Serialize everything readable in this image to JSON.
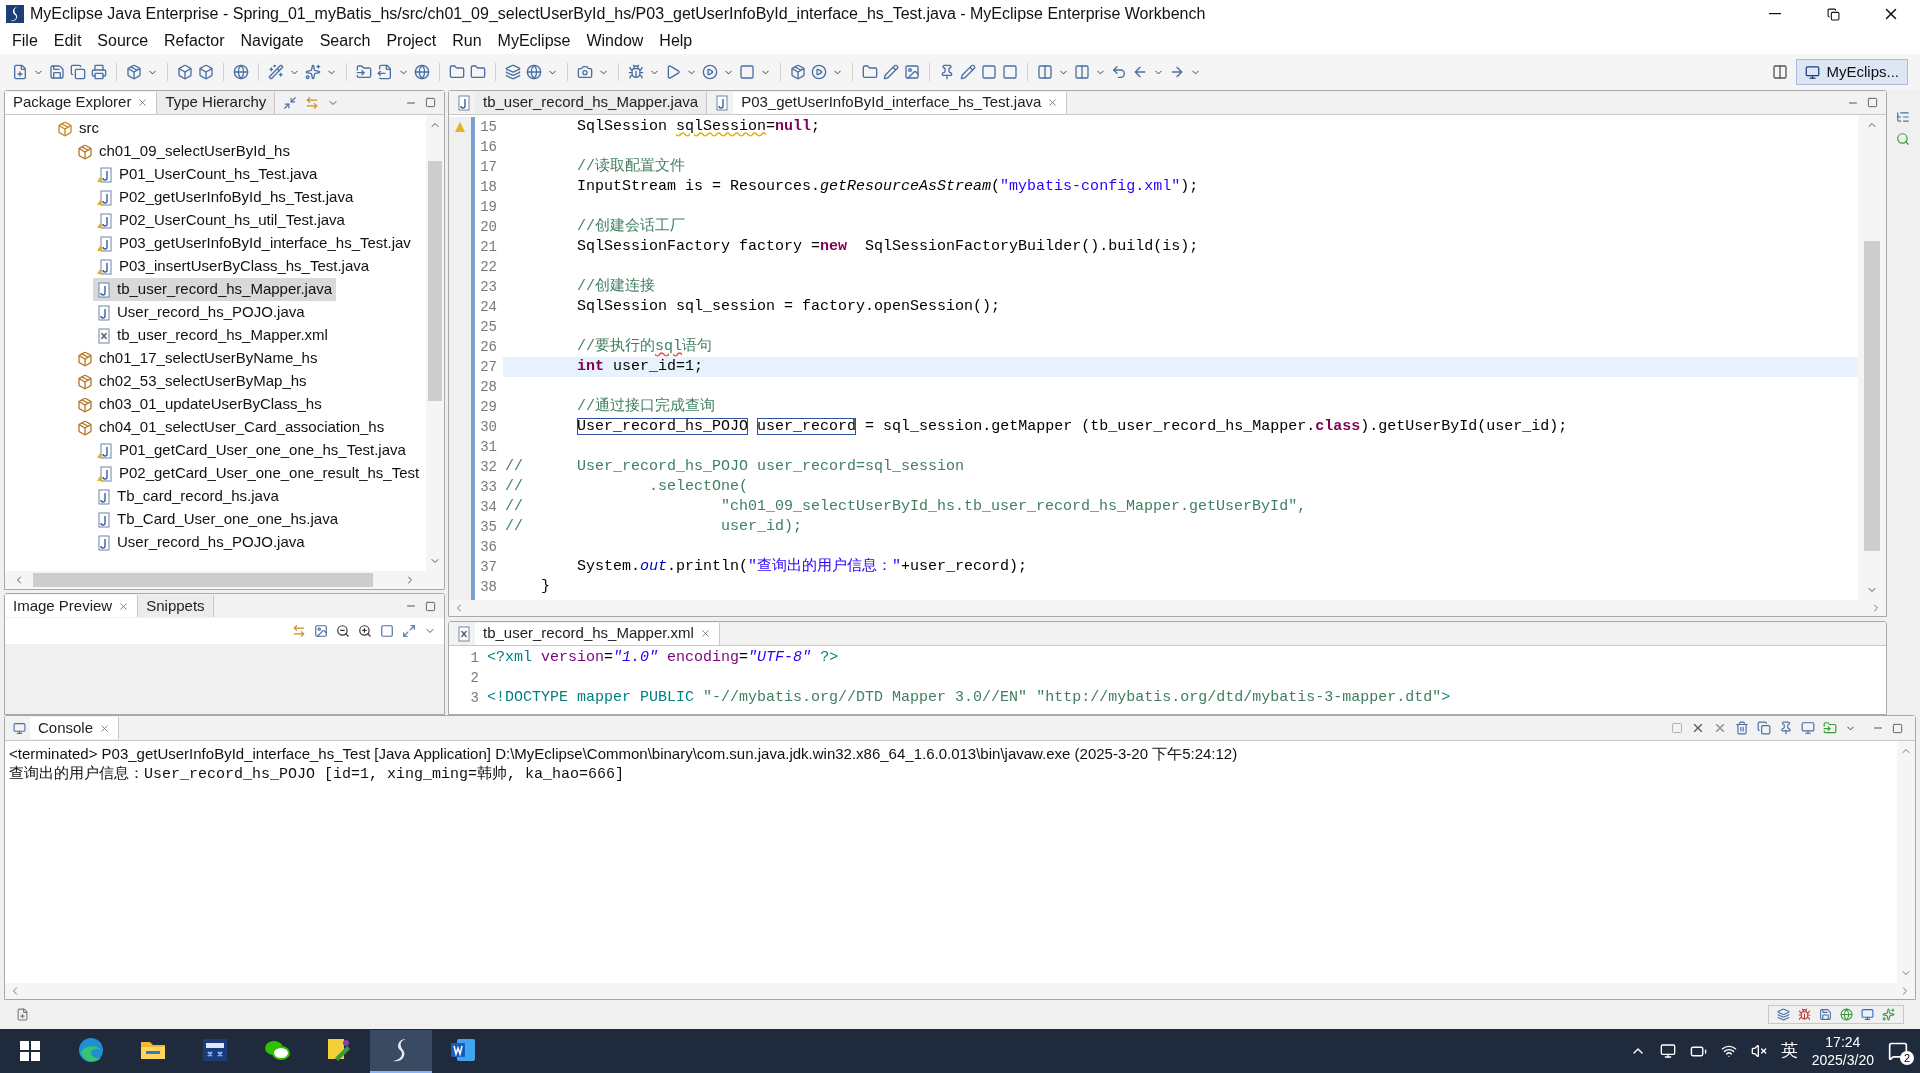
{
  "window": {
    "title": "MyEclipse Java Enterprise - Spring_01_myBatis_hs/src/ch01_09_selectUserById_hs/P03_getUserInfoById_interface_hs_Test.java - MyEclipse Enterprise Workbench"
  },
  "menu": [
    "File",
    "Edit",
    "Source",
    "Refactor",
    "Navigate",
    "Search",
    "Project",
    "Run",
    "MyEclipse",
    "Window",
    "Help"
  ],
  "perspective": {
    "label": "MyEclips..."
  },
  "package_explorer": {
    "tabs": [
      {
        "label": "Package Explorer",
        "selected": true
      },
      {
        "label": "Type Hierarchy",
        "selected": false
      }
    ],
    "tree": [
      {
        "label": "src",
        "kind": "source-folder",
        "selected": false,
        "children": [
          {
            "label": "ch01_09_selectUserById_hs",
            "kind": "package",
            "selected": false,
            "children": [
              {
                "label": "P01_UserCount_hs_Test.java",
                "kind": "java-warning",
                "selected": false
              },
              {
                "label": "P02_getUserInfoById_hs_Test.java",
                "kind": "java-warning",
                "selected": false
              },
              {
                "label": "P02_UserCount_hs_util_Test.java",
                "kind": "java-warning",
                "selected": false
              },
              {
                "label": "P03_getUserInfoById_interface_hs_Test.jav",
                "kind": "java-warning",
                "selected": false
              },
              {
                "label": "P03_insertUserByClass_hs_Test.java",
                "kind": "java-warning",
                "selected": false
              },
              {
                "label": "tb_user_record_hs_Mapper.java",
                "kind": "java",
                "selected": true
              },
              {
                "label": "User_record_hs_POJO.java",
                "kind": "java",
                "selected": false
              },
              {
                "label": "tb_user_record_hs_Mapper.xml",
                "kind": "xml",
                "selected": false
              }
            ]
          },
          {
            "label": "ch01_17_selectUserByName_hs",
            "kind": "package",
            "selected": false
          },
          {
            "label": "ch02_53_selectUserByMap_hs",
            "kind": "package",
            "selected": false
          },
          {
            "label": "ch03_01_updateUserByClass_hs",
            "kind": "package",
            "selected": false
          },
          {
            "label": "ch04_01_selectUser_Card_association_hs",
            "kind": "package",
            "selected": false,
            "children": [
              {
                "label": "P01_getCard_User_one_one_hs_Test.java",
                "kind": "java-warning",
                "selected": false
              },
              {
                "label": "P02_getCard_User_one_one_result_hs_Test",
                "kind": "java-warning",
                "selected": false
              },
              {
                "label": "Tb_card_record_hs.java",
                "kind": "java",
                "selected": false
              },
              {
                "label": "Tb_Card_User_one_one_hs.java",
                "kind": "java",
                "selected": false
              },
              {
                "label": "User_record_hs_POJO.java",
                "kind": "java",
                "selected": false
              }
            ]
          }
        ]
      }
    ]
  },
  "image_preview": {
    "tabs": [
      {
        "label": "Image Preview",
        "selected": true
      },
      {
        "label": "Snippets",
        "selected": false
      }
    ]
  },
  "editor": {
    "tabs": [
      {
        "label": "tb_user_record_hs_Mapper.java",
        "selected": false
      },
      {
        "label": "P03_getUserInfoById_interface_hs_Test.java",
        "selected": true
      }
    ],
    "lines": [
      {
        "number": "15",
        "current": false,
        "warning": true,
        "tokens": [
          {
            "text": "        SqlSession ",
            "kind": "plain"
          },
          {
            "text": "sqlSession",
            "kind": "warn"
          },
          {
            "text": "=",
            "kind": "plain"
          },
          {
            "text": "null",
            "kind": "keyword"
          },
          {
            "text": ";",
            "kind": "plain"
          }
        ]
      },
      {
        "number": "16",
        "current": false,
        "warning": false
      },
      {
        "number": "17",
        "current": false,
        "warning": false,
        "tokens": [
          {
            "text": "        //读取配置文件",
            "kind": "comment"
          }
        ]
      },
      {
        "number": "18",
        "current": false,
        "warning": false,
        "tokens": [
          {
            "text": "        InputStream is = Resources.",
            "kind": "plain"
          },
          {
            "text": "getResourceAsStream",
            "kind": "italic"
          },
          {
            "text": "(",
            "kind": "plain"
          },
          {
            "text": "\"mybatis-config.xml\"",
            "kind": "string"
          },
          {
            "text": ");",
            "kind": "plain"
          }
        ]
      },
      {
        "number": "19",
        "current": false,
        "warning": false
      },
      {
        "number": "20",
        "current": false,
        "warning": false,
        "tokens": [
          {
            "text": "        //创建会话工厂",
            "kind": "comment"
          }
        ]
      },
      {
        "number": "21",
        "current": false,
        "warning": false,
        "tokens": [
          {
            "text": "        SqlSessionFactory factory =",
            "kind": "plain"
          },
          {
            "text": "new",
            "kind": "keyword"
          },
          {
            "text": "  SqlSessionFactoryBuilder().build(is);",
            "kind": "plain"
          }
        ]
      },
      {
        "number": "22",
        "current": false,
        "warning": false
      },
      {
        "number": "23",
        "current": false,
        "warning": false,
        "tokens": [
          {
            "text": "        //创建连接",
            "kind": "comment"
          }
        ]
      },
      {
        "number": "24",
        "current": false,
        "warning": false,
        "tokens": [
          {
            "text": "        SqlSession sql_session = factory.openSession();",
            "kind": "plain"
          }
        ]
      },
      {
        "number": "25",
        "current": false,
        "warning": false
      },
      {
        "number": "26",
        "current": false,
        "warning": false,
        "tokens": [
          {
            "text": "        //要执行的",
            "kind": "comment"
          },
          {
            "text": "sql",
            "kind": "comment-warn"
          },
          {
            "text": "语句",
            "kind": "comment"
          }
        ]
      },
      {
        "number": "27",
        "current": true,
        "warning": false,
        "tokens": [
          {
            "text": "        int",
            "kind": "keyword"
          },
          {
            "text": " user_id=1;",
            "kind": "plain"
          }
        ]
      },
      {
        "number": "28",
        "current": false,
        "warning": false
      },
      {
        "number": "29",
        "current": false,
        "warning": false,
        "tokens": [
          {
            "text": "        //通过接口完成查询",
            "kind": "comment"
          }
        ]
      },
      {
        "number": "30",
        "current": false,
        "warning": false,
        "tokens": [
          {
            "text": "        User_record_hs_POJO",
            "kind": "occurrence"
          },
          {
            "text": " user_record",
            "kind": "occurrence"
          },
          {
            "text": " = sql_session.getMapper (tb_user_record_hs_Mapper.",
            "kind": "plain"
          },
          {
            "text": "class",
            "kind": "keyword"
          },
          {
            "text": ").getUserById(user_id);",
            "kind": "plain"
          }
        ]
      },
      {
        "number": "31",
        "current": false,
        "warning": false
      },
      {
        "number": "32",
        "current": false,
        "warning": false,
        "tokens": [
          {
            "text": "//      User_record_hs_POJO user_record=sql_session",
            "kind": "comment"
          }
        ]
      },
      {
        "number": "33",
        "current": false,
        "warning": false,
        "tokens": [
          {
            "text": "//              .selectOne(",
            "kind": "comment"
          }
        ]
      },
      {
        "number": "34",
        "current": false,
        "warning": false,
        "tokens": [
          {
            "text": "//                      \"ch01_09_selectUserById_hs.tb_user_record_hs_Mapper.getUserById\",",
            "kind": "comment"
          }
        ]
      },
      {
        "number": "35",
        "current": false,
        "warning": false,
        "tokens": [
          {
            "text": "//                      user_id);",
            "kind": "comment"
          }
        ]
      },
      {
        "number": "36",
        "current": false,
        "warning": false
      },
      {
        "number": "37",
        "current": false,
        "warning": false,
        "tokens": [
          {
            "text": "        System.",
            "kind": "plain"
          },
          {
            "text": "out",
            "kind": "field"
          },
          {
            "text": ".println(",
            "kind": "plain"
          },
          {
            "text": "\"查询出的用户信息：\"",
            "kind": "string"
          },
          {
            "text": "+user_record);",
            "kind": "plain"
          }
        ]
      },
      {
        "number": "38",
        "current": false,
        "warning": false,
        "tokens": [
          {
            "text": "    }",
            "kind": "plain"
          }
        ]
      }
    ]
  },
  "xml_editor": {
    "tabs": [
      {
        "label": "tb_user_record_hs_Mapper.xml",
        "selected": true
      }
    ],
    "lines": [
      {
        "number": "1",
        "tokens": [
          {
            "text": "<?xml ",
            "kind": "tag"
          },
          {
            "text": "version",
            "kind": "attr"
          },
          {
            "text": "=",
            "kind": "plain"
          },
          {
            "text": "\"1.0\"",
            "kind": "value"
          },
          {
            "text": " encoding",
            "kind": "attr"
          },
          {
            "text": "=",
            "kind": "plain"
          },
          {
            "text": "\"UTF-8\"",
            "kind": "value"
          },
          {
            "text": " ?>",
            "kind": "tag"
          }
        ]
      },
      {
        "number": "2"
      },
      {
        "number": "3",
        "tokens": [
          {
            "text": "<!DOCTYPE mapper PUBLIC ",
            "kind": "tag"
          },
          {
            "text": "\"-//mybatis.org//DTD Mapper 3.0//EN\"",
            "kind": "doc"
          },
          {
            "text": " \"http://mybatis.org/dtd/mybatis-3-mapper.dtd\"",
            "kind": "doc"
          },
          {
            "text": ">",
            "kind": "tag"
          }
        ]
      }
    ]
  },
  "console": {
    "tabs": [
      {
        "label": "Console",
        "selected": true
      }
    ],
    "header": "<terminated> P03_getUserInfoById_interface_hs_Test [Java Application] D:\\MyEclipse\\Common\\binary\\com.sun.java.jdk.win32.x86_64_1.6.0.013\\bin\\javaw.exe (2025-3-20 下午5:24:12)",
    "output": [
      "查询出的用户信息：User_record_hs_POJO [id=1, xing_ming=韩帅, ka_hao=666]"
    ]
  },
  "taskbar": {
    "apps": [
      {
        "kind": "browser",
        "selected": false
      },
      {
        "kind": "folder",
        "selected": false
      },
      {
        "kind": "dev",
        "selected": false
      },
      {
        "kind": "chat",
        "selected": false
      },
      {
        "kind": "tool",
        "selected": false
      },
      {
        "kind": "eclipse",
        "selected": true
      },
      {
        "kind": "word",
        "selected": false
      }
    ],
    "ime": "英",
    "time": "17:24",
    "date": "2025/3/20",
    "notifications": "2"
  }
}
